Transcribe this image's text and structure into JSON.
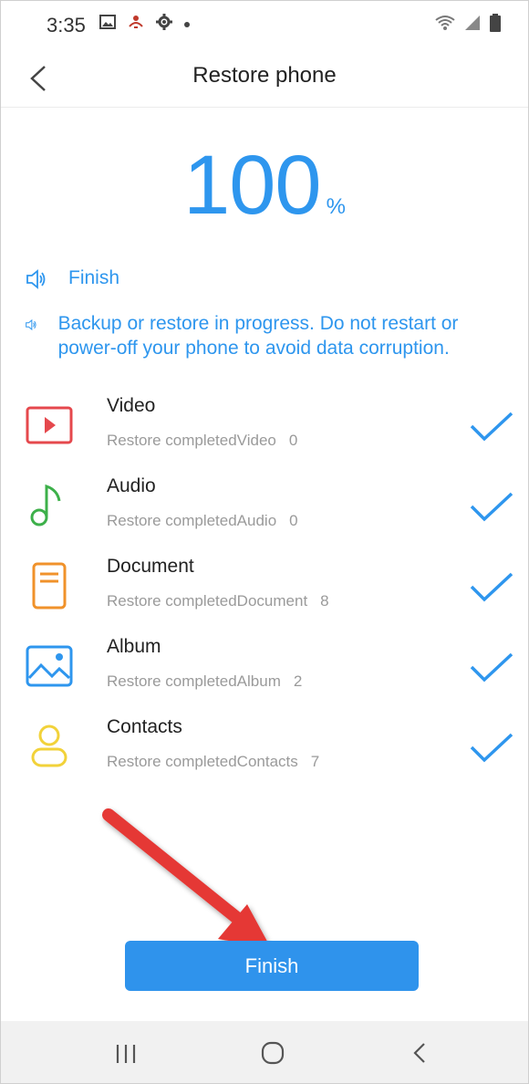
{
  "status_bar": {
    "time": "3:35",
    "icons_left": [
      "gallery-icon",
      "notification-icon",
      "settings-icon",
      "dot-icon"
    ],
    "icons_right": [
      "wifi-icon",
      "signal-icon",
      "battery-icon"
    ]
  },
  "app_bar": {
    "title": "Restore phone",
    "back_icon": "chevron-left-icon"
  },
  "progress": {
    "value": "100",
    "unit": "%"
  },
  "messages": [
    {
      "icon": "speaker-icon",
      "text": "Finish"
    },
    {
      "icon": "speaker-icon",
      "text": "Backup or restore in progress. Do not restart or power-off your phone to avoid data corruption."
    }
  ],
  "items": [
    {
      "name": "Video",
      "status": "Restore completedVideo",
      "count": "0",
      "icon": "video-icon",
      "color": "#e5484d"
    },
    {
      "name": "Audio",
      "status": "Restore completedAudio",
      "count": "0",
      "icon": "music-note-icon",
      "color": "#3db04a"
    },
    {
      "name": "Document",
      "status": "Restore completedDocument",
      "count": "8",
      "icon": "document-icon",
      "color": "#f0922b"
    },
    {
      "name": "Album",
      "status": "Restore completedAlbum",
      "count": "2",
      "icon": "album-icon",
      "color": "#2e96ee"
    },
    {
      "name": "Contacts",
      "status": "Restore completedContacts",
      "count": "7",
      "icon": "contact-icon",
      "color": "#f2d23a"
    }
  ],
  "finish_button": {
    "label": "Finish"
  },
  "colors": {
    "accent": "#2e96ee",
    "check": "#2e96ee",
    "arrow": "#e53935"
  },
  "nav_bar": {
    "items": [
      "recents-icon",
      "home-icon",
      "back-icon"
    ]
  }
}
